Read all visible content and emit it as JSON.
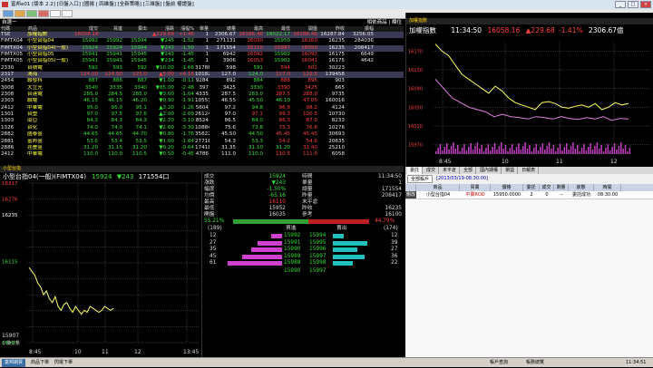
{
  "window": {
    "title": "富邦e01 [版本 2.2] [日盤入口] [國揚 | 四維盤] [全新策略] [三維盤] [盤前 權證盤]"
  },
  "quote_panel": {
    "title": "自選一",
    "right_label": "相依商品 | 欄位",
    "columns": [
      "代碼",
      "商品",
      "成交",
      "買進",
      "賣出",
      "漲跌",
      "漲幅%",
      "單量",
      "總量",
      "最高",
      "最低",
      "開盤",
      "昨收",
      "振幅"
    ],
    "rows": [
      {
        "code": "TSE",
        "name": "加權指數",
        "v": [
          "16058.16",
          "",
          "",
          "▲229.68",
          "+1.45",
          "1",
          "2306.67",
          "16186.46",
          "16022.17",
          "16186.46",
          "16287.84",
          "3256.05"
        ],
        "cls": "up",
        "hl": true
      },
      {
        "code": "FIMTX04",
        "name": "小型台指04",
        "v": [
          "15992",
          "15992",
          "15994",
          "▼245",
          "-1.52",
          "1",
          "271131",
          "16090",
          "15950",
          "16260",
          "16235",
          "284036"
        ],
        "cls": "dn"
      },
      {
        "code": "FIMTX04",
        "name": "小型台指04(一般)",
        "v": [
          "15924",
          "15924",
          "15994",
          "▼243",
          "-1.50",
          "1",
          "171554",
          "16110",
          "15987",
          "16050",
          "16235",
          "208417"
        ],
        "cls": "dn",
        "hl": true
      },
      {
        "code": "FIMTX05",
        "name": "小型台指05",
        "v": [
          "15941",
          "15941",
          "15945",
          "▼243",
          "-1.45",
          "1",
          "6942",
          "16092",
          "15902",
          "16092",
          "16175",
          "6649"
        ],
        "cls": "dn"
      },
      {
        "code": "FIMTX05",
        "name": "小型台指05(一般)",
        "v": [
          "15941",
          "15941",
          "15945",
          "▼234",
          "-1.45",
          "1",
          "3906",
          "16053",
          "15902",
          "16041",
          "16175",
          "4642"
        ],
        "cls": "dn"
      },
      {
        "code": "2330",
        "name": "台積電",
        "v": [
          "592",
          "593",
          "592",
          "▼10.00",
          "-1.66",
          "31788",
          "598",
          "591",
          "594",
          "602",
          "30223",
          ""
        ],
        "cls": "dn"
      },
      {
        "code": "2317",
        "name": "鴻海",
        "v": [
          "124.50",
          "124.50",
          "125.0",
          "▲5.00",
          "+4.18",
          "101823",
          "127.0",
          "124.0",
          "127.0",
          "129.5",
          "139458",
          ""
        ],
        "cls": "up",
        "hl": true
      },
      {
        "code": "2454",
        "name": "聯發科",
        "v": [
          "887",
          "886",
          "887",
          "▼1.00",
          "-0.11",
          "9284",
          "892",
          "884",
          "888",
          "895",
          "903",
          ""
        ],
        "cls": "dn"
      },
      {
        "code": "3008",
        "name": "大立光",
        "v": [
          "3340",
          "3335",
          "3340",
          "▼85.00",
          "-2.48",
          "397",
          "3425",
          "3330",
          "3390",
          "3425",
          "665",
          ""
        ],
        "cls": "dn"
      },
      {
        "code": "2308",
        "name": "台達電",
        "v": [
          "285.0",
          "284.5",
          "285.0",
          "▼3.00",
          "-1.04",
          "4335",
          "287.5",
          "283.0",
          "287.5",
          "288.0",
          "9735",
          ""
        ],
        "cls": "dn"
      },
      {
        "code": "2303",
        "name": "聯電",
        "v": [
          "46.15",
          "46.15",
          "46.20",
          "▼0.90",
          "-1.91",
          "105578",
          "46.55",
          "45.50",
          "46.10",
          "47.05",
          "160016",
          ""
        ],
        "cls": "dn"
      },
      {
        "code": "2412",
        "name": "中華電",
        "v": [
          "95.0",
          "95.0",
          "95.1",
          "▲3.20",
          "-1.26",
          "5604",
          "97.2",
          "94.8",
          "96.9",
          "98.2",
          "4124",
          ""
        ],
        "cls": "dn"
      },
      {
        "code": "1301",
        "name": "台塑",
        "v": [
          "97.0",
          "97.5",
          "97.6",
          "▲2.00",
          "-2.09",
          "26124",
          "97.0",
          "97.1",
          "99.3",
          "100.5",
          "10730",
          ""
        ],
        "cls": "dn"
      },
      {
        "code": "1303",
        "name": "南亞",
        "v": [
          "84.3",
          "84.3",
          "84.3",
          "▼2.70",
          "-3.10",
          "8524",
          "86.5",
          "84.0",
          "86.3",
          "87.0",
          "8233",
          ""
        ],
        "cls": "dn"
      },
      {
        "code": "1326",
        "name": "台化",
        "v": [
          "74.0",
          "74.0",
          "74.1",
          "▼2.60",
          "-3.39",
          "10884",
          "75.6",
          "73.8",
          "75.3",
          "76.6",
          "10276",
          ""
        ],
        "cls": "dn"
      },
      {
        "code": "2882",
        "name": "國泰金",
        "v": [
          "44.65",
          "44.65",
          "44.70",
          "▼0.80",
          "-1.76",
          "35622",
          "45.50",
          "44.50",
          "45.45",
          "45.45",
          "30693",
          ""
        ],
        "cls": "dn"
      },
      {
        "code": "2881",
        "name": "富邦金",
        "v": [
          "53.6",
          "53.4",
          "53.5",
          "▼1.00",
          "-1.84",
          "27716",
          "54.3",
          "53.3",
          "54.2",
          "54.6",
          "20635",
          ""
        ],
        "cls": "dn"
      },
      {
        "code": "2886",
        "name": "兆豐金",
        "v": [
          "31.20",
          "31.15",
          "31.20",
          "▼0.20",
          "-0.64",
          "17418",
          "31.35",
          "31.10",
          "31.20",
          "31.40",
          "25210",
          ""
        ],
        "cls": "dn"
      },
      {
        "code": "2412",
        "name": "中華電",
        "v": [
          "110.0",
          "110.0",
          "110.5",
          "▼0.50",
          "-0.45",
          "4786",
          "111.0",
          "110.0",
          "110.5",
          "111.0",
          "6058",
          ""
        ],
        "cls": "dn"
      }
    ]
  },
  "tick_panel": {
    "tab": "加權指數",
    "name": "加權指數",
    "time": "11:34:50",
    "price": "16058.16",
    "change": "▲229.68",
    "pct": "-1.41%",
    "amount": "2306.67億",
    "ylabels": [
      "16170",
      "16130",
      "16090",
      "16050",
      "16010",
      "15970"
    ],
    "xlabels": [
      "8:45",
      "10",
      "11",
      "12"
    ]
  },
  "futures_chart": {
    "tab": "小型台指",
    "title": "小型台指04(一般)(FIMTX04)",
    "price": "15924",
    "change": "▼243",
    "vol": "171554口",
    "ylabels": [
      "16317",
      "16276",
      "16235",
      "16194",
      "16153",
      "16112",
      "16071",
      "16030",
      "15989",
      "15948",
      "15907"
    ],
    "left_labels": [
      "16317",
      "16276",
      "16235",
      "16115",
      "15907"
    ],
    "xlabels": [
      "8:45",
      "10",
      "11",
      "12",
      "13:45"
    ],
    "vol_label": "小量分量",
    "vol_value": "1,7:1,000"
  },
  "futures_quote": {
    "left": [
      [
        "成交",
        "15924"
      ],
      [
        "漲跌",
        "▼243"
      ],
      [
        "幅度",
        "-1.50%"
      ],
      [
        "均價",
        "-65.16"
      ],
      [
        "最高",
        "16110"
      ],
      [
        "最低",
        "15952"
      ],
      [
        "開盤",
        "16035"
      ]
    ],
    "right": [
      [
        "時間",
        "11:34:50"
      ],
      [
        "單量",
        "1"
      ],
      [
        "總量",
        "171554"
      ],
      [
        "昨量",
        "208417"
      ],
      [
        "未平倉",
        ""
      ],
      [
        "昨收",
        "16235"
      ],
      [
        "參考",
        "16100"
      ]
    ],
    "buy_pct": "55.21%",
    "sell_pct": "44.79%",
    "buy_total": "(189)",
    "sell_total": "(174)",
    "buy_hdr": "買進",
    "sell_hdr": "賣出",
    "bids": [
      [
        "12",
        "15992"
      ],
      [
        "27",
        "15991"
      ],
      [
        "35",
        "15990"
      ],
      [
        "45",
        "15989"
      ],
      [
        "61",
        "15988"
      ]
    ],
    "asks": [
      [
        "15994",
        "12"
      ],
      [
        "15995",
        "39"
      ],
      [
        "15996",
        "27"
      ],
      [
        "15997",
        "36"
      ],
      [
        "15998",
        "22"
      ]
    ],
    "bid_sum": "15990",
    "ask_sum": "15997"
  },
  "order_panel": {
    "tabs": [
      "委託",
      "成交",
      "未平倉",
      "全部",
      "國內期權",
      "損益",
      "日報表"
    ],
    "account_label": "全部帳戶",
    "account_value": "[2013/03/19-08:30:00]",
    "cols": [
      "",
      "商品",
      "買賣",
      "價格",
      "委託",
      "成交",
      "剩量",
      "狀態",
      "時間"
    ],
    "row": [
      "刪改",
      "小型台指04",
      "平賣ROD",
      "15950.0000",
      "2",
      "0",
      "--",
      "委託成功",
      "08:30:00"
    ]
  },
  "statusbar": {
    "left": "富邦期貨",
    "item2": "商品下單",
    "item3": "閃電下單",
    "right1": "帳戶查詢",
    "right2": "帳務總覽",
    "time": "11:34:51"
  },
  "colors": {
    "up": "#ff4040",
    "down": "#33e033",
    "accent": "#ffd200",
    "line1": "#ffff60",
    "line2": "#e080e0",
    "bg": "#000000"
  }
}
